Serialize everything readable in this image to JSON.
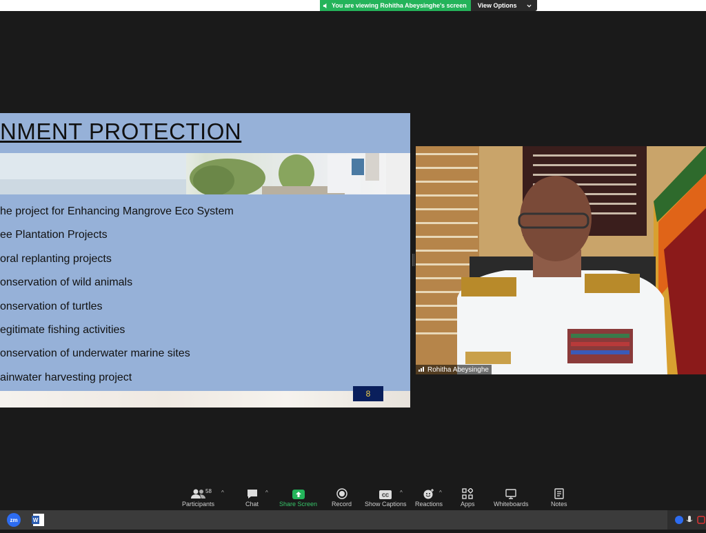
{
  "banner": {
    "viewing_text": "You are viewing Rohitha Abeysinghe's screen",
    "view_options_label": "View Options"
  },
  "slide": {
    "title": "NMENT PROTECTION",
    "bullets": [
      "he project for Enhancing Mangrove Eco System",
      "ee Plantation Projects",
      "oral replanting projects",
      "onservation of wild animals",
      "onservation of turtles",
      "egitimate fishing activities",
      "onservation of underwater marine sites",
      "ainwater harvesting project"
    ],
    "page_number": "8"
  },
  "video": {
    "participant_name": "Rohitha Abeysinghe"
  },
  "toolbar": {
    "participants_label": "Participants",
    "participants_count": "58",
    "chat_label": "Chat",
    "share_screen_label": "Share Screen",
    "record_label": "Record",
    "show_captions_label": "Show Captions",
    "reactions_label": "Reactions",
    "apps_label": "Apps",
    "whiteboards_label": "Whiteboards",
    "notes_label": "Notes"
  },
  "taskbar": {
    "zoom_label": "zm",
    "word_label": "W"
  },
  "colors": {
    "share_green": "#24b35a",
    "slide_bg": "#96b1d8",
    "page_num_bg": "#0a1f5c",
    "page_num_text": "#f5d34a"
  }
}
